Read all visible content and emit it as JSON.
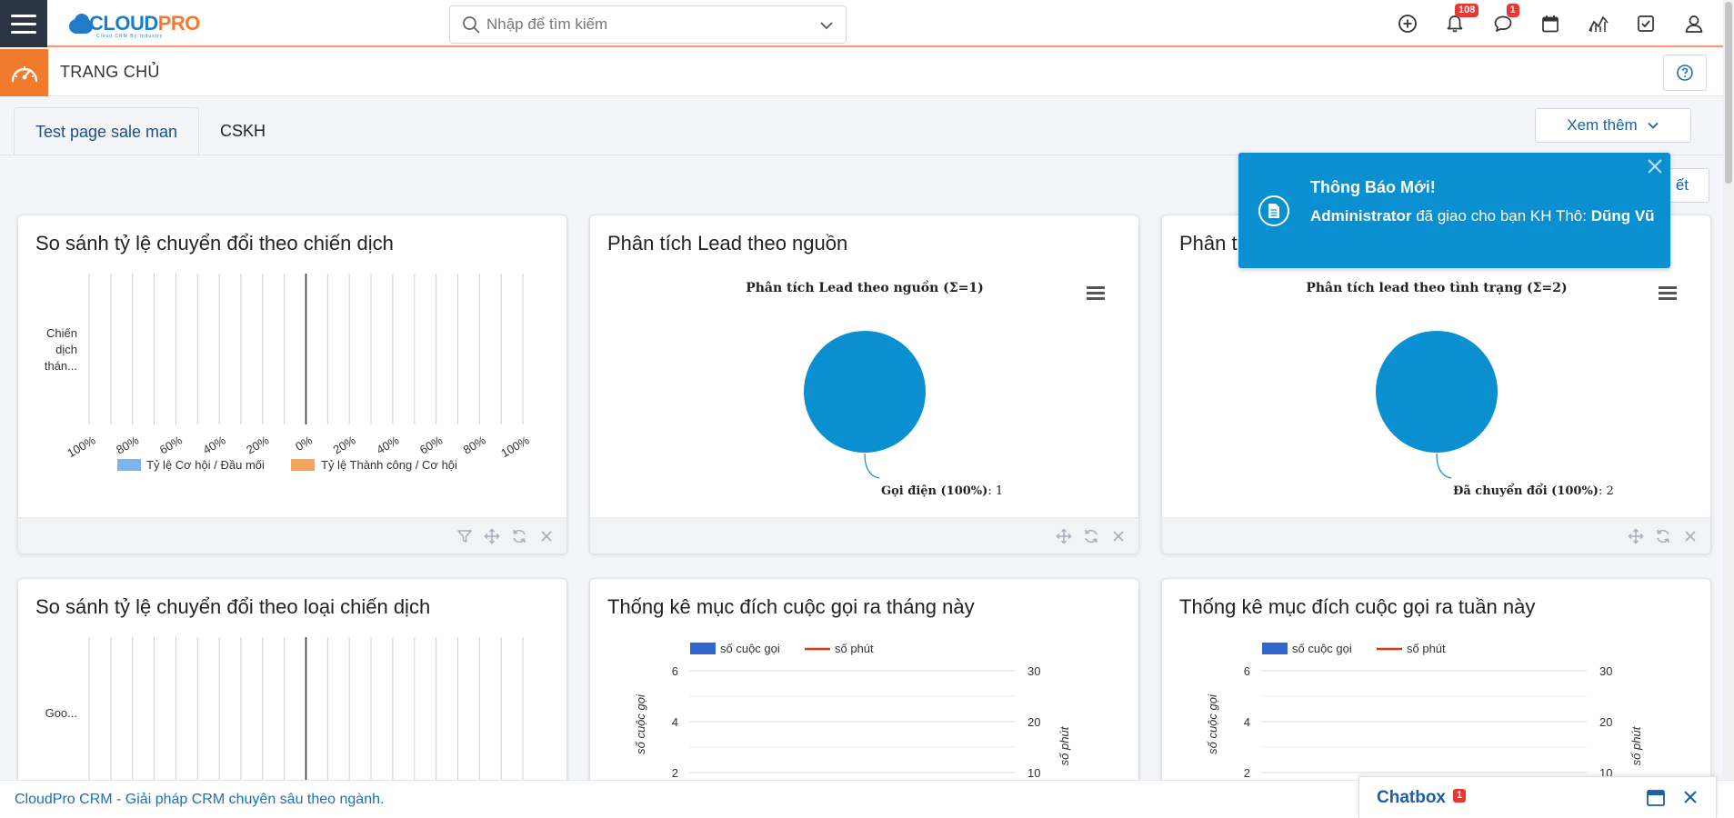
{
  "topbar": {
    "logo_text_a": "CLOUD",
    "logo_text_b": "PRO",
    "logo_sub": "Cloud CRM By Industry",
    "search_placeholder": "Nhập để tìm kiếm",
    "notification_count": "108",
    "message_count": "1"
  },
  "header": {
    "title": "TRANG CHỦ"
  },
  "tabs": [
    {
      "label": "Test page sale man"
    },
    {
      "label": "CSKH"
    }
  ],
  "more_button": "Xem thêm",
  "hidden_button_tail": "ết",
  "widgets": {
    "w1": {
      "title": "So sánh tỷ lệ chuyển đổi theo chiến dịch",
      "category": [
        "Chiến",
        "dịch",
        "thán..."
      ],
      "ticks": [
        "100%",
        "80%",
        "60%",
        "40%",
        "20%",
        "0%",
        "20%",
        "40%",
        "60%",
        "80%",
        "100%"
      ],
      "legend": [
        "Tỷ lệ Cơ hội / Đầu mối",
        "Tỷ lệ Thành công / Cơ hội"
      ]
    },
    "w2": {
      "title": "Phân tích Lead theo nguồn",
      "chart_title": "Phân tích Lead theo nguồn (Σ=1)",
      "slice_label": "Gọi điện (100%)",
      "slice_value": ": 1"
    },
    "w3": {
      "title": "Phân t",
      "chart_title": "Phân tích lead theo tình trạng (Σ=2)",
      "slice_label": "Đã chuyển đổi (100%)",
      "slice_value": ": 2"
    },
    "w4": {
      "title": "So sánh tỷ lệ chuyển đổi theo loại chiến dịch",
      "category": "Goo..."
    },
    "w5": {
      "title": "Thống kê mục đích cuộc gọi ra tháng này",
      "legend": [
        "số cuộc gọi",
        "số phút"
      ],
      "left_ticks": [
        "6",
        "4",
        "2"
      ],
      "right_ticks": [
        "30",
        "20",
        "10"
      ],
      "left_axis": "số cuộc gọi",
      "right_axis": "số phút"
    },
    "w6": {
      "title": "Thống kê mục đích cuộc gọi ra tuần này",
      "legend": [
        "số cuộc gọi",
        "số phút"
      ],
      "left_ticks": [
        "6",
        "4",
        "2"
      ],
      "right_ticks": [
        "30",
        "20",
        "10"
      ],
      "left_axis": "số cuộc gọi",
      "right_axis": "số phút"
    }
  },
  "chart_data": [
    {
      "type": "bar",
      "title": "",
      "categories": [
        "Chiến dịch thán..."
      ],
      "series": [
        {
          "name": "Tỷ lệ Cơ hội / Đầu mối",
          "values": [
            0
          ]
        },
        {
          "name": "Tỷ lệ Thành công / Cơ hội",
          "values": [
            0
          ]
        }
      ],
      "xlim": [
        -100,
        100
      ],
      "colors": [
        "#7cb5ec",
        "#f7a35c"
      ]
    },
    {
      "type": "pie",
      "title": "Phân tích Lead theo nguồn (Σ=1)",
      "labels": [
        "Gọi điện"
      ],
      "values": [
        1
      ],
      "colors": [
        "#0a8fd1"
      ]
    },
    {
      "type": "pie",
      "title": "Phân tích lead theo tình trạng (Σ=2)",
      "labels": [
        "Đã chuyển đổi"
      ],
      "values": [
        2
      ],
      "colors": [
        "#0a8fd1"
      ]
    },
    {
      "type": "bar",
      "title": "",
      "categories": [
        "Goo..."
      ],
      "series": [],
      "xlim": [
        -100,
        100
      ]
    },
    {
      "type": "bar",
      "title": "",
      "series": [
        {
          "name": "số cuộc gọi",
          "values": []
        },
        {
          "name": "số phút",
          "values": []
        }
      ],
      "ylim": [
        0,
        6
      ],
      "y2lim": [
        0,
        30
      ],
      "ylabel": "số cuộc gọi",
      "y2label": "số phút",
      "colors": [
        "#3366cc",
        "#dc3912"
      ]
    },
    {
      "type": "bar",
      "title": "",
      "series": [
        {
          "name": "số cuộc gọi",
          "values": []
        },
        {
          "name": "số phút",
          "values": []
        }
      ],
      "ylim": [
        0,
        6
      ],
      "y2lim": [
        0,
        30
      ],
      "ylabel": "số cuộc gọi",
      "y2label": "số phút",
      "colors": [
        "#3366cc",
        "#dc3912"
      ]
    }
  ],
  "notification": {
    "title": "Thông Báo Mới!",
    "actor": "Administrator",
    "message": " đã giao cho bạn KH Thô: ",
    "target": "Dũng Vũ"
  },
  "footer": {
    "text": "CloudPro CRM - Giải pháp CRM chuyên sâu theo ngành."
  },
  "chatbox": {
    "title": "Chatbox",
    "badge": "1"
  },
  "colors": {
    "accent": "#f07b2d",
    "brand": "#1e7cc8",
    "pie": "#0a8fd1",
    "notify": "#0a8fd1"
  }
}
